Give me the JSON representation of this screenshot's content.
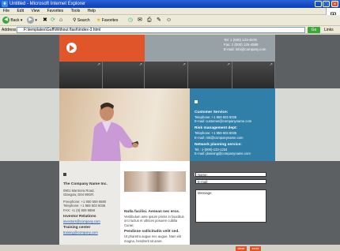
{
  "window": {
    "title": "Untitled - Microsoft Internet Explorer",
    "controls": [
      "_",
      "□",
      "×"
    ]
  },
  "menu": [
    "File",
    "Edit",
    "View",
    "Favorites",
    "Tools",
    "Help"
  ],
  "toolbar": {
    "back_label": "Back",
    "search_label": "Search",
    "favorites_label": "Favorites"
  },
  "address": {
    "label": "Address",
    "value": "F:\\templates\\Guff\\Without flash\\index-3.html",
    "go_label": "Go",
    "links_label": "Links"
  },
  "header_contact": {
    "tel": "Tel:  1 (000) 123-4578",
    "fax": "Fax:  1 (000) 125-4589",
    "email": "E-mail: info@company.com"
  },
  "services": {
    "customer_title": "Customer Service:",
    "customer_phone": "Telephone:  +1 959 603 6035",
    "customer_email": "E-mail: customer@companyname.com",
    "risk_title": "Risk management dept:",
    "risk_phone": "Telephone:  +1 959 603 6035",
    "risk_email": "E-mail: risk@companyname.com",
    "network_title": "Network planning service:",
    "network_phone": "Tel.: 1-(000)-123-1234",
    "network_email": "E-mail: planning@companyname.com"
  },
  "company": {
    "name": "The Company Name Inc.",
    "address1": "0901 Marmora Road,",
    "address2": "Glasgow, D04 89GR.",
    "freephone": "Freephone:  +1 800 559 6580",
    "telephone": "Telephone:  +1 959 603 6035",
    "fax": "FAX:          +1 (0) 809 9898",
    "investor_title": "Investor Relations",
    "investor_email": "investors@company.com",
    "training_title": "Training center",
    "training_email": "training@company.com"
  },
  "news": {
    "headline1": "Nulla facilisi. Aenean nec eros.",
    "text1a": "Vestibulum ante ipsum primis in faucibus",
    "text1b": "orci luctus et ultrices posuere cubilia",
    "text1c": "Curae;",
    "headline2": "Pendisse sollicitudin velit sed.",
    "text2a": "Ut pharetra augue nec augue. Nam elit",
    "text2b": "magna, hendrerit sit amet."
  },
  "form": {
    "name_placeholder": "Name:",
    "email_placeholder": "E-mail:",
    "message_placeholder": "Message:",
    "clear_label": "clear",
    "send_label": "send"
  }
}
